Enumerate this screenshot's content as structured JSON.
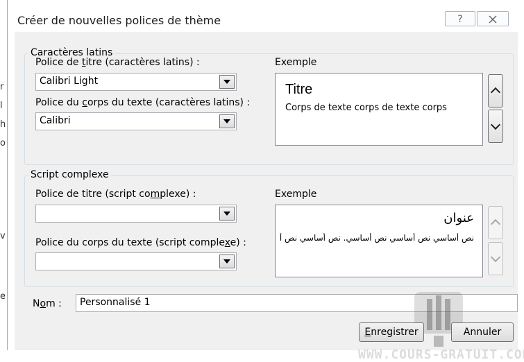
{
  "dialog": {
    "title": "Créer de nouvelles polices de thème",
    "help_glyph": "?",
    "close_glyph": "☒"
  },
  "latin": {
    "group_label": "Caractères latins",
    "heading_font_label_pre": "Police de ",
    "heading_font_label_u": "t",
    "heading_font_label_post": "itre (caractères latins) :",
    "heading_font_value": "Calibri Light",
    "body_font_label_pre": "Police du ",
    "body_font_label_u": "c",
    "body_font_label_post": "orps du texte (caractères latins) :",
    "body_font_value": "Calibri",
    "sample_label": "Exemple",
    "sample_title": "Titre",
    "sample_body": "Corps de texte corps de texte corps"
  },
  "complex": {
    "group_label": "Script complexe",
    "heading_font_label_pre": "Police de titre (script co",
    "heading_font_label_u": "m",
    "heading_font_label_post": "plexe) :",
    "heading_font_value": "",
    "body_font_label_pre": "Police du corps du texte (script comple",
    "body_font_label_u": "x",
    "body_font_label_post": "e) :",
    "body_font_value": "",
    "sample_label": "Exemple",
    "sample_title": "عنوان",
    "sample_body": "نص أساسي نص أساسي نص أساسي. نص أساسي نص أساسي"
  },
  "name": {
    "label_pre": "N",
    "label_u": "o",
    "label_post": "m :",
    "value": "Personnalisé 1"
  },
  "buttons": {
    "save_u": "E",
    "save_rest": "nregistrer",
    "cancel": "Annuler"
  },
  "background_fragments": [
    "r",
    "l",
    "h",
    "o",
    "v",
    "e"
  ],
  "watermark_text": "WWW.COURS-GRATUIT.COM"
}
